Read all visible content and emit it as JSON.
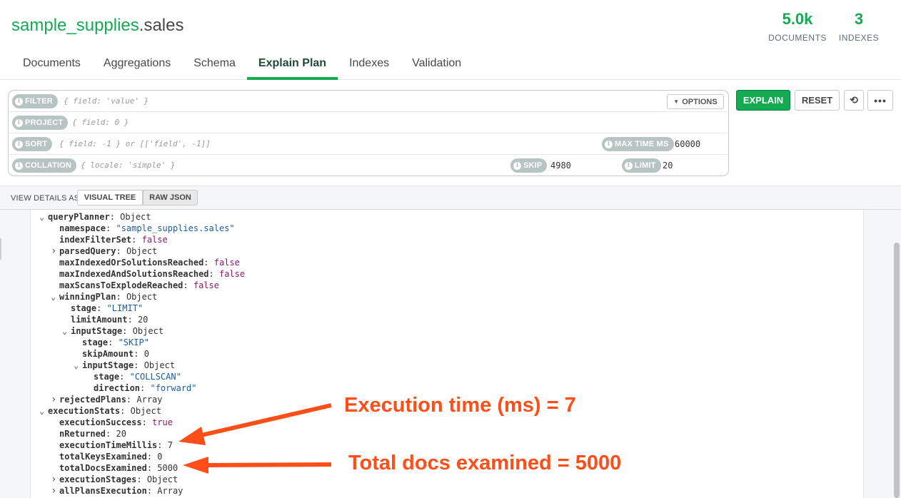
{
  "header": {
    "db": "sample_supplies",
    "coll": ".sales",
    "stats": [
      {
        "value": "5.0k",
        "label": "DOCUMENTS"
      },
      {
        "value": "3",
        "label": "INDEXES"
      }
    ]
  },
  "tabs": [
    {
      "label": "Documents"
    },
    {
      "label": "Aggregations"
    },
    {
      "label": "Schema"
    },
    {
      "label": "Explain Plan",
      "active": true
    },
    {
      "label": "Indexes"
    },
    {
      "label": "Validation"
    }
  ],
  "query_bar": {
    "filter": {
      "label": "FILTER",
      "placeholder": "{ field: 'value' }"
    },
    "project": {
      "label": "PROJECT",
      "placeholder": "{ field: 0 }"
    },
    "sort": {
      "label": "SORT",
      "placeholder": "{ field: -1 } or [['field', -1]]"
    },
    "collation": {
      "label": "COLLATION",
      "placeholder": "{ locale: 'simple' }"
    },
    "max_time": {
      "label": "MAX TIME MS",
      "value": "60000"
    },
    "skip": {
      "label": "SKIP",
      "value": "4980"
    },
    "limit": {
      "label": "LIMIT",
      "value": "20"
    },
    "options_label": "OPTIONS",
    "info_glyph": "i"
  },
  "actions": {
    "explain": "EXPLAIN",
    "reset": "RESET",
    "history_glyph": "⟲",
    "more_glyph": "•••"
  },
  "view_details": {
    "label": "VIEW DETAILS AS",
    "visual_tree": "VISUAL TREE",
    "raw_json": "RAW JSON",
    "selected": "RAW JSON"
  },
  "json_tree": [
    {
      "indent": 0,
      "toggle": "v",
      "key": "queryPlanner",
      "type": "Object"
    },
    {
      "indent": 1,
      "key": "namespace",
      "value": "\"sample_supplies.sales\"",
      "vtype": "s"
    },
    {
      "indent": 1,
      "key": "indexFilterSet",
      "value": "false",
      "vtype": "b"
    },
    {
      "indent": 1,
      "toggle": ">",
      "key": "parsedQuery",
      "type": "Object"
    },
    {
      "indent": 1,
      "key": "maxIndexedOrSolutionsReached",
      "value": "false",
      "vtype": "b"
    },
    {
      "indent": 1,
      "key": "maxIndexedAndSolutionsReached",
      "value": "false",
      "vtype": "b"
    },
    {
      "indent": 1,
      "key": "maxScansToExplodeReached",
      "value": "false",
      "vtype": "b"
    },
    {
      "indent": 1,
      "toggle": "v",
      "key": "winningPlan",
      "type": "Object"
    },
    {
      "indent": 2,
      "key": "stage",
      "value": "\"LIMIT\"",
      "vtype": "s"
    },
    {
      "indent": 2,
      "key": "limitAmount",
      "value": "20",
      "vtype": "n"
    },
    {
      "indent": 2,
      "toggle": "v",
      "key": "inputStage",
      "type": "Object"
    },
    {
      "indent": 3,
      "key": "stage",
      "value": "\"SKIP\"",
      "vtype": "s"
    },
    {
      "indent": 3,
      "key": "skipAmount",
      "value": "0",
      "vtype": "n"
    },
    {
      "indent": 3,
      "toggle": "v",
      "key": "inputStage",
      "type": "Object"
    },
    {
      "indent": 4,
      "key": "stage",
      "value": "\"COLLSCAN\"",
      "vtype": "s"
    },
    {
      "indent": 4,
      "key": "direction",
      "value": "\"forward\"",
      "vtype": "s"
    },
    {
      "indent": 1,
      "toggle": ">",
      "key": "rejectedPlans",
      "type": "Array"
    },
    {
      "indent": 0,
      "toggle": "v",
      "key": "executionStats",
      "type": "Object"
    },
    {
      "indent": 1,
      "key": "executionSuccess",
      "value": "true",
      "vtype": "b"
    },
    {
      "indent": 1,
      "key": "nReturned",
      "value": "20",
      "vtype": "n"
    },
    {
      "indent": 1,
      "key": "executionTimeMillis",
      "value": "7",
      "vtype": "n"
    },
    {
      "indent": 1,
      "key": "totalKeysExamined",
      "value": "0",
      "vtype": "n"
    },
    {
      "indent": 1,
      "key": "totalDocsExamined",
      "value": "5000",
      "vtype": "n"
    },
    {
      "indent": 1,
      "toggle": ">",
      "key": "executionStages",
      "type": "Object"
    },
    {
      "indent": 1,
      "toggle": ">",
      "key": "allPlansExecution",
      "type": "Array"
    }
  ],
  "annotations": {
    "time": "Execution time (ms) = 7",
    "docs": "Total docs examined = 5000",
    "color": "#ff4e17"
  },
  "colors": {
    "accent": "#13aa52",
    "pill": "#b8c4c2"
  }
}
